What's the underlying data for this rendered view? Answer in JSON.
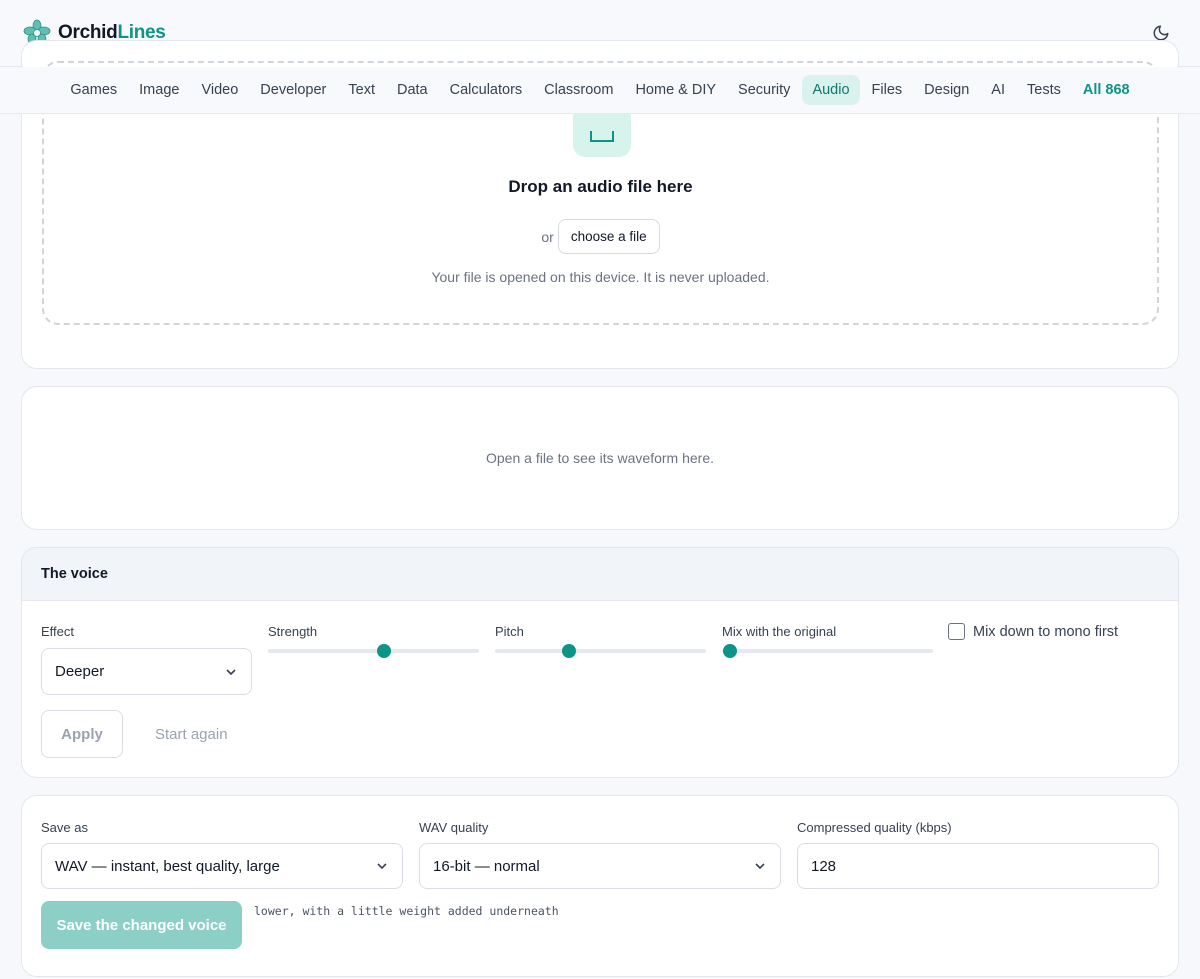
{
  "brand": {
    "name_part1": "Orchid",
    "name_part2": "Lines"
  },
  "nav": {
    "items": [
      "Games",
      "Image",
      "Video",
      "Developer",
      "Text",
      "Data",
      "Calculators",
      "Classroom",
      "Home & DIY",
      "Security",
      "Audio",
      "Files",
      "Design",
      "AI",
      "Tests"
    ],
    "active": "Audio",
    "all_label": "All 868"
  },
  "drop": {
    "title": "Drop an audio file here",
    "or_text": "or",
    "choose_label": "choose a file",
    "note": "Your file is opened on this device. It is never uploaded."
  },
  "waveform": {
    "placeholder": "Open a file to see its waveform here."
  },
  "voice": {
    "heading": "The voice",
    "effect_label": "Effect",
    "effect_value": "Deeper",
    "strength_label": "Strength",
    "strength_level": 0.55,
    "pitch_label": "Pitch",
    "pitch_level": 0.35,
    "mix_label": "Mix with the original",
    "mix_level": 0.04,
    "mono_label": "Mix down to mono first",
    "mono_checked": false,
    "apply_label": "Apply",
    "restart_label": "Start again"
  },
  "save": {
    "save_as_label": "Save as",
    "save_as_value": "WAV — instant, best quality, large",
    "wav_quality_label": "WAV quality",
    "wav_quality_value": "16-bit — normal",
    "compressed_label": "Compressed quality (kbps)",
    "compressed_value": "128",
    "save_button": "Save the changed voice",
    "note": "lower, with a little weight added underneath"
  },
  "colors": {
    "accent": "#0d9488",
    "accent_soft": "#d9f2ee",
    "save_disabled": "#8ccfc6"
  }
}
